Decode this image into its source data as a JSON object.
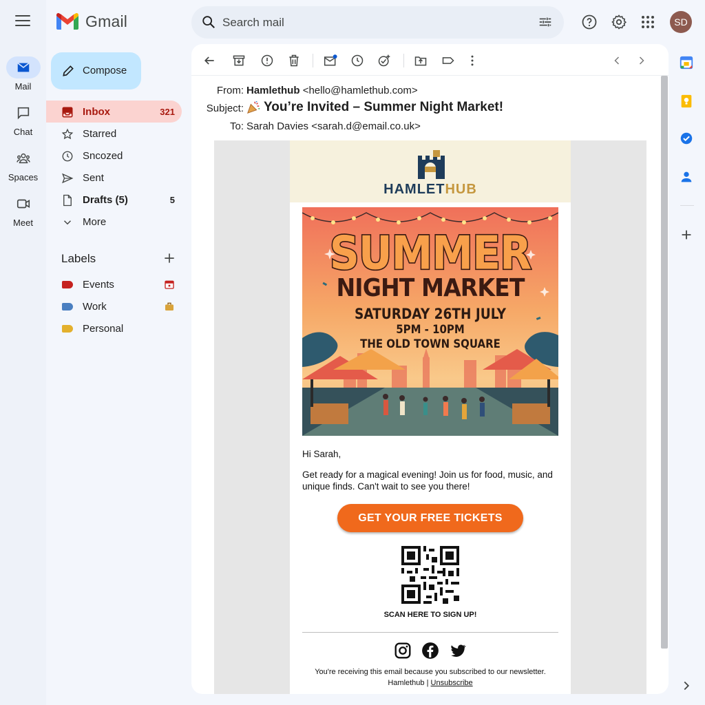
{
  "app": {
    "logo_text": "Gmail"
  },
  "rail": {
    "items": [
      {
        "label": "Mail",
        "icon": "mail-icon"
      },
      {
        "label": "Chat",
        "icon": "chat-icon"
      },
      {
        "label": "Spaces",
        "icon": "spaces-icon"
      },
      {
        "label": "Meet",
        "icon": "meet-icon"
      }
    ]
  },
  "search": {
    "placeholder": "Search mail"
  },
  "user": {
    "initials": "SD",
    "avatar_color": "#8d5a4f"
  },
  "compose": {
    "label": "Compose"
  },
  "nav": {
    "items": [
      {
        "label": "Inbox",
        "count": "321"
      },
      {
        "label": "Starred",
        "count": ""
      },
      {
        "label": "Sncozed",
        "count": ""
      },
      {
        "label": "Sent",
        "count": ""
      },
      {
        "label": "Drafts (5)",
        "count": "5"
      },
      {
        "label": "More",
        "count": ""
      }
    ]
  },
  "labels": {
    "title": "Labels",
    "items": [
      {
        "label": "Events",
        "color": "#c5221f"
      },
      {
        "label": "Work",
        "color": "#4a7fc1"
      },
      {
        "label": "Personal",
        "color": "#e3b02d"
      }
    ]
  },
  "message": {
    "from_label": "From:",
    "from_name": "Hamlethub",
    "from_email": "<hello@hamlethub.com>",
    "subject_label": "Subject:",
    "subject": "You’re Invited – Summer Night Market!",
    "to_label": "To:",
    "to": "Sarah Davies <sarah.d@email.co.uk>"
  },
  "email": {
    "brand_part1": "HAMLET",
    "brand_part2": "HUB",
    "poster": {
      "line1": "SUMMER",
      "line2": "NIGHT MARKET",
      "line3": "SATURDAY 26TH JULY",
      "line4": "5PM - 10PM",
      "line5": "THE OLD TOWN SQUARE"
    },
    "greeting": "Hi Sarah,",
    "body": "Get ready for a magical evening! Join us for food, music, and unique finds. Can't wait to see you there!",
    "cta": "GET YOUR FREE TICKETS",
    "qr_caption": "SCAN HERE TO SIGN UP!",
    "footer_line1": "You're receiving this email because you subscribed to our newsletter.",
    "footer_brand": "Hamlethub |",
    "unsubscribe": "Unsubscribe"
  },
  "colors": {
    "accent_cta": "#f0691c",
    "inbox_highlight": "#fbd3d0",
    "compose_bg": "#c2e7ff"
  }
}
